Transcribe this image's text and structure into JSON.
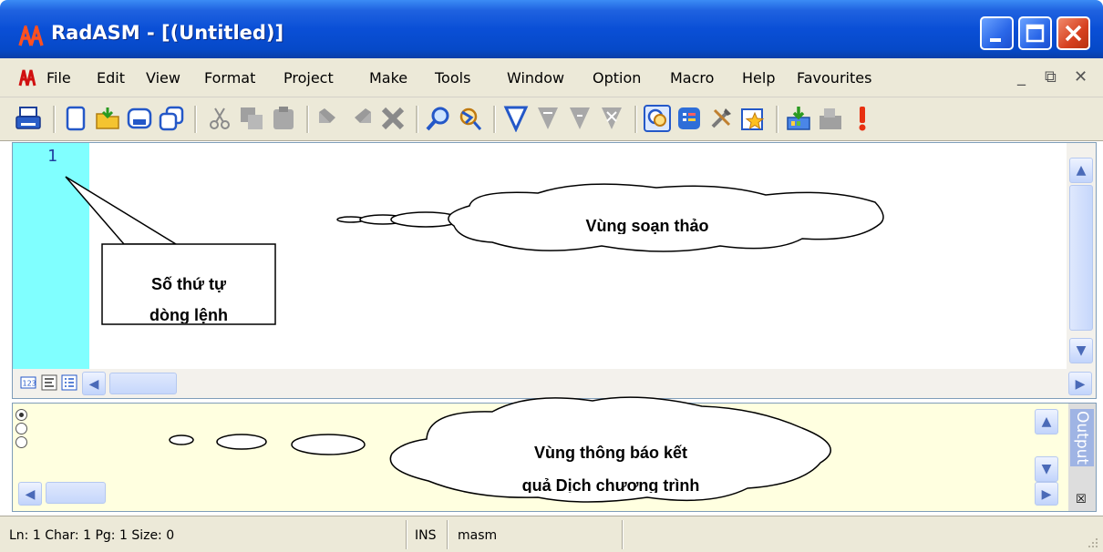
{
  "window": {
    "title": "RadASM - [(Untitled)]"
  },
  "menu": {
    "items": [
      "File",
      "Edit",
      "View",
      "Format",
      "Project",
      "Make",
      "Tools",
      "Window",
      "Option",
      "Macro",
      "Help",
      "Favourites"
    ]
  },
  "editor": {
    "line_numbers": [
      "1"
    ]
  },
  "output": {
    "tab_label": "Output"
  },
  "status": {
    "position": "Ln: 1  Char: 1  Pg: 1  Size: 0",
    "mode": "INS",
    "assembler": "masm"
  },
  "annotations": {
    "line_number_callout": [
      "Số thứ tự",
      "dòng lệnh"
    ],
    "editor_callout": "Vùng soạn thảo",
    "output_callout": [
      "Vùng thông báo kết",
      "quả Dịch chương trình"
    ]
  },
  "colors": {
    "titlebar": "#0a4fd6",
    "gutter": "#80ffff",
    "output_bg": "#ffffe0",
    "chrome": "#ece9d8"
  }
}
